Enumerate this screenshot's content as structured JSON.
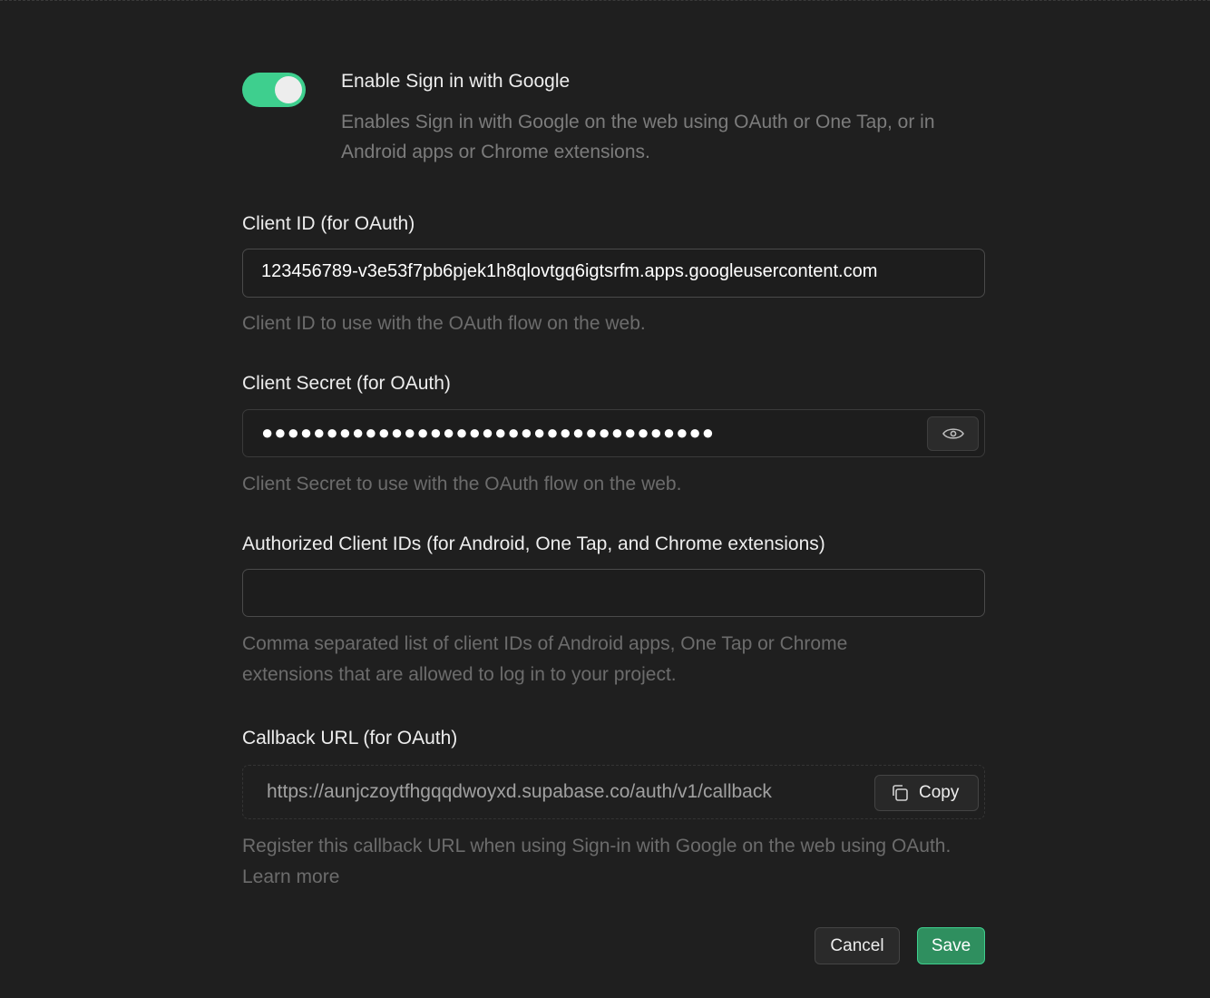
{
  "toggle": {
    "title": "Enable Sign in with Google",
    "description": "Enables Sign in with Google on the web using OAuth or One Tap, or in Android apps or Chrome extensions.",
    "enabled": true,
    "accent": "#3ecf8e"
  },
  "client_id": {
    "label": "Client ID (for OAuth)",
    "value": "123456789-v3e53f7pb6pjek1h8qlovtgq6igtsrfm.apps.googleusercontent.com",
    "hint": "Client ID to use with the OAuth flow on the web."
  },
  "client_secret": {
    "label": "Client Secret (for OAuth)",
    "value": "●●●●●●●●●●●●●●●●●●●●●●●●●●●●●●●●●●●",
    "reveal_icon": "eye-icon",
    "hint": "Client Secret to use with the OAuth flow on the web."
  },
  "authorized_ids": {
    "label": "Authorized Client IDs (for Android, One Tap, and Chrome extensions)",
    "value": "",
    "hint": "Comma separated list of client IDs of Android apps, One Tap or Chrome extensions that are allowed to log in to your project."
  },
  "callback": {
    "label": "Callback URL (for OAuth)",
    "value": "https://aunjczoytfhgqqdwoyxd.supabase.co/auth/v1/callback",
    "copy_label": "Copy",
    "copy_icon": "copy-icon",
    "hint": "Register this callback URL when using Sign-in with Google on the web using OAuth. Learn more"
  },
  "actions": {
    "cancel_label": "Cancel",
    "save_label": "Save",
    "save_color": "#2f8f5f"
  }
}
